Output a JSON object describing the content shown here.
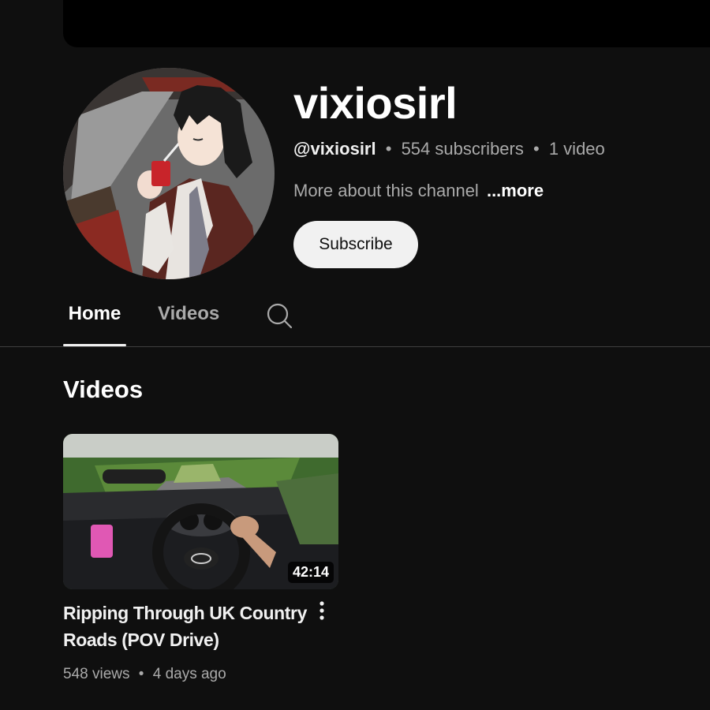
{
  "channel": {
    "name": "vixiosirl",
    "handle": "@vixiosirl",
    "subscribers": "554 subscribers",
    "video_count": "1 video",
    "separator": "•",
    "about_text": "More about this channel",
    "more_label": "...more",
    "subscribe_label": "Subscribe"
  },
  "tabs": [
    {
      "label": "Home",
      "active": true
    },
    {
      "label": "Videos",
      "active": false
    }
  ],
  "search_icon": "search-icon",
  "section": {
    "title": "Videos"
  },
  "videos": [
    {
      "title": "Ripping Through UK Country Roads (POV Drive)",
      "duration": "42:14",
      "views": "548 views",
      "age": "4 days ago"
    }
  ],
  "colors": {
    "background": "#0f0f0f",
    "text_primary": "#f1f1f1",
    "text_secondary": "#aaaaaa",
    "subscribe_bg": "#f1f1f1"
  }
}
